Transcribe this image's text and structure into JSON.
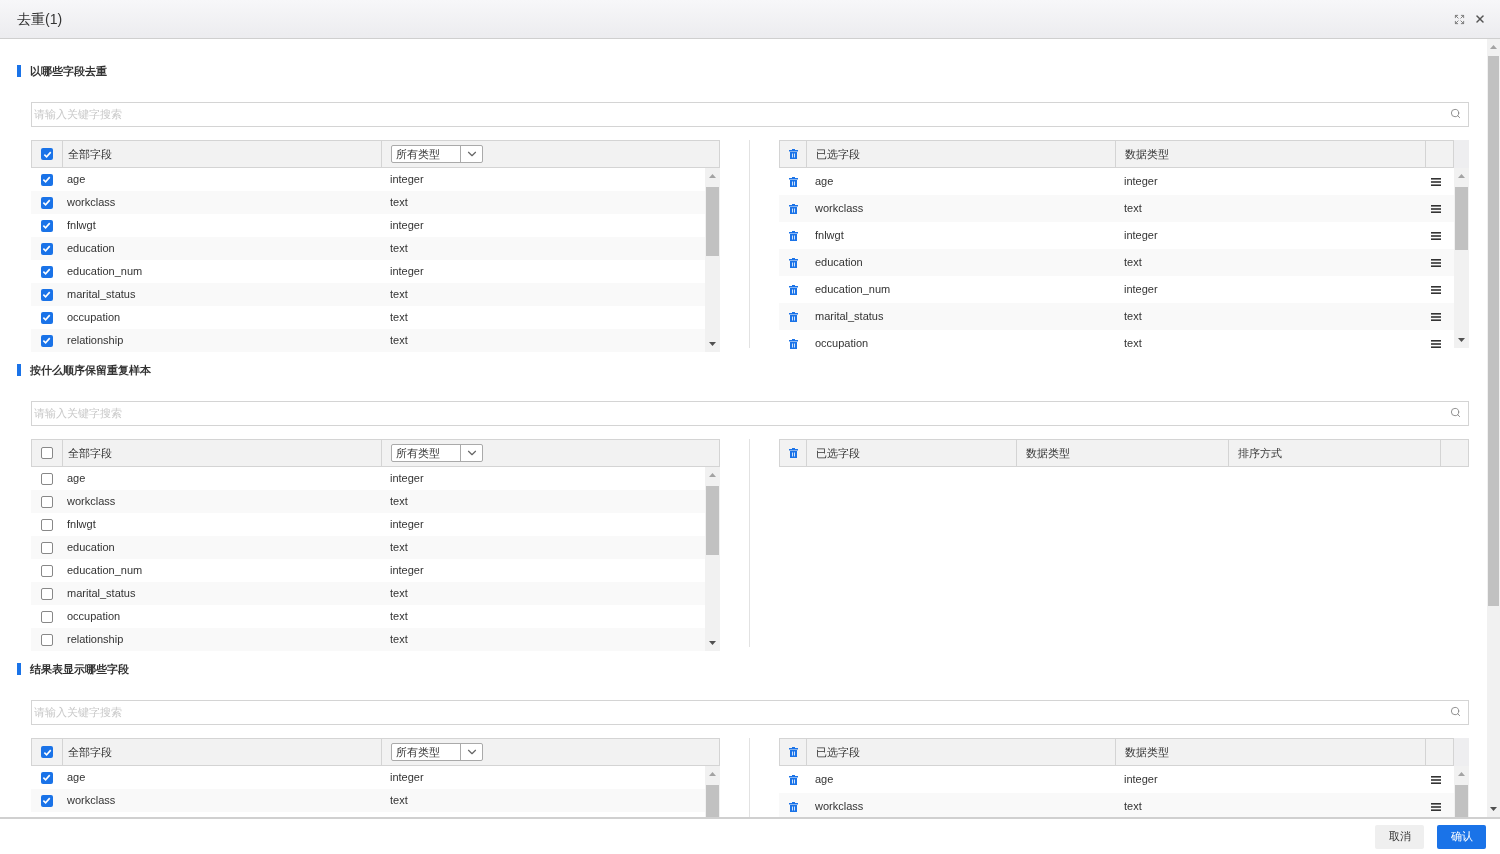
{
  "window": {
    "title": "去重(1)"
  },
  "sections": [
    {
      "title": "以哪些字段去重",
      "search_placeholder": "请输入关键字搜索",
      "left": {
        "select_all_checked": true,
        "header": "全部字段",
        "type_filter": "所有类型",
        "rows": [
          {
            "name": "age",
            "type": "integer",
            "checked": true
          },
          {
            "name": "workclass",
            "type": "text",
            "checked": true
          },
          {
            "name": "fnlwgt",
            "type": "integer",
            "checked": true
          },
          {
            "name": "education",
            "type": "text",
            "checked": true
          },
          {
            "name": "education_num",
            "type": "integer",
            "checked": true
          },
          {
            "name": "marital_status",
            "type": "text",
            "checked": true
          },
          {
            "name": "occupation",
            "type": "text",
            "checked": true
          },
          {
            "name": "relationship",
            "type": "text",
            "checked": true
          }
        ]
      },
      "right": {
        "columns": [
          "已选字段",
          "数据类型"
        ],
        "rows": [
          {
            "name": "age",
            "type": "integer"
          },
          {
            "name": "workclass",
            "type": "text"
          },
          {
            "name": "fnlwgt",
            "type": "integer"
          },
          {
            "name": "education",
            "type": "text"
          },
          {
            "name": "education_num",
            "type": "integer"
          },
          {
            "name": "marital_status",
            "type": "text"
          },
          {
            "name": "occupation",
            "type": "text"
          }
        ]
      }
    },
    {
      "title": "按什么顺序保留重复样本",
      "search_placeholder": "请输入关键字搜索",
      "left": {
        "select_all_checked": false,
        "header": "全部字段",
        "type_filter": "所有类型",
        "rows": [
          {
            "name": "age",
            "type": "integer",
            "checked": false
          },
          {
            "name": "workclass",
            "type": "text",
            "checked": false
          },
          {
            "name": "fnlwgt",
            "type": "integer",
            "checked": false
          },
          {
            "name": "education",
            "type": "text",
            "checked": false
          },
          {
            "name": "education_num",
            "type": "integer",
            "checked": false
          },
          {
            "name": "marital_status",
            "type": "text",
            "checked": false
          },
          {
            "name": "occupation",
            "type": "text",
            "checked": false
          },
          {
            "name": "relationship",
            "type": "text",
            "checked": false
          }
        ]
      },
      "right": {
        "columns": [
          "已选字段",
          "数据类型",
          "排序方式"
        ]
      }
    },
    {
      "title": "结果表显示哪些字段",
      "search_placeholder": "请输入关键字搜索",
      "left": {
        "select_all_checked": true,
        "header": "全部字段",
        "type_filter": "所有类型",
        "rows": [
          {
            "name": "age",
            "type": "integer",
            "checked": true
          },
          {
            "name": "workclass",
            "type": "text",
            "checked": true
          }
        ]
      },
      "right": {
        "columns": [
          "已选字段",
          "数据类型"
        ],
        "rows": [
          {
            "name": "age",
            "type": "integer"
          },
          {
            "name": "workclass",
            "type": "text"
          }
        ]
      }
    }
  ],
  "footer": {
    "cancel": "取消",
    "confirm": "确认"
  }
}
